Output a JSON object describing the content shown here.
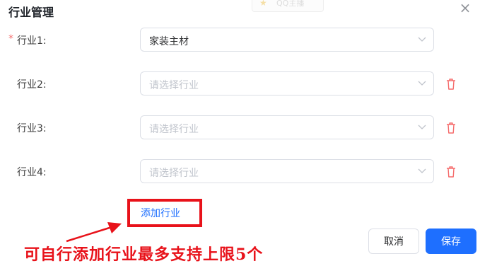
{
  "dialog": {
    "title": "行业管理",
    "close_label": "×",
    "ghost_tag_text": "QQ主播"
  },
  "rows": [
    {
      "label": "行业1:",
      "required": true,
      "value": "家装主材",
      "placeholder": "",
      "deletable": false
    },
    {
      "label": "行业2:",
      "required": false,
      "value": "",
      "placeholder": "请选择行业",
      "deletable": true
    },
    {
      "label": "行业3:",
      "required": false,
      "value": "",
      "placeholder": "请选择行业",
      "deletable": true
    },
    {
      "label": "行业4:",
      "required": false,
      "value": "",
      "placeholder": "请选择行业",
      "deletable": true
    }
  ],
  "required_mark": "*",
  "add_link": "添加行业",
  "annotation": "可自行添加行业最多支持上限5个",
  "buttons": {
    "cancel": "取消",
    "save": "保存"
  },
  "colors": {
    "primary": "#1e6fff",
    "danger": "#f56c6c",
    "annotation_red": "#e8121a"
  },
  "icons": {
    "close": "close-icon",
    "dropdown": "chevron-down-icon",
    "delete": "trash-icon"
  }
}
